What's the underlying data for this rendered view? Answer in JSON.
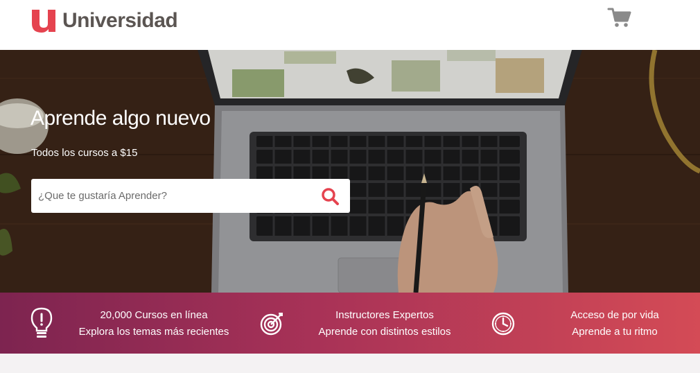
{
  "header": {
    "logo_text": "Universidad",
    "logo_mark_letter": "u",
    "brand_color": "#e5434f",
    "cart_icon": "shopping-cart-icon"
  },
  "hero": {
    "title": "Aprende algo nuevo",
    "subtitle": "Todos los cursos a $15",
    "search": {
      "placeholder": "¿Que te gustaría Aprender?",
      "value": "",
      "icon": "search-icon"
    }
  },
  "features": [
    {
      "icon": "lightbulb-icon",
      "line1": "20,000 Cursos en línea",
      "line2": "Explora los temas más recientes"
    },
    {
      "icon": "target-icon",
      "line1": "Instructores Expertos",
      "line2": "Aprende con distintos estilos"
    },
    {
      "icon": "clock-icon",
      "line1": "Acceso de por vida",
      "line2": "Aprende a tu ritmo"
    }
  ],
  "colors": {
    "features_gradient_start": "#7d2450",
    "features_gradient_end": "#d44b56",
    "search_icon": "#e5434f",
    "logo_text": "#5b5552"
  }
}
